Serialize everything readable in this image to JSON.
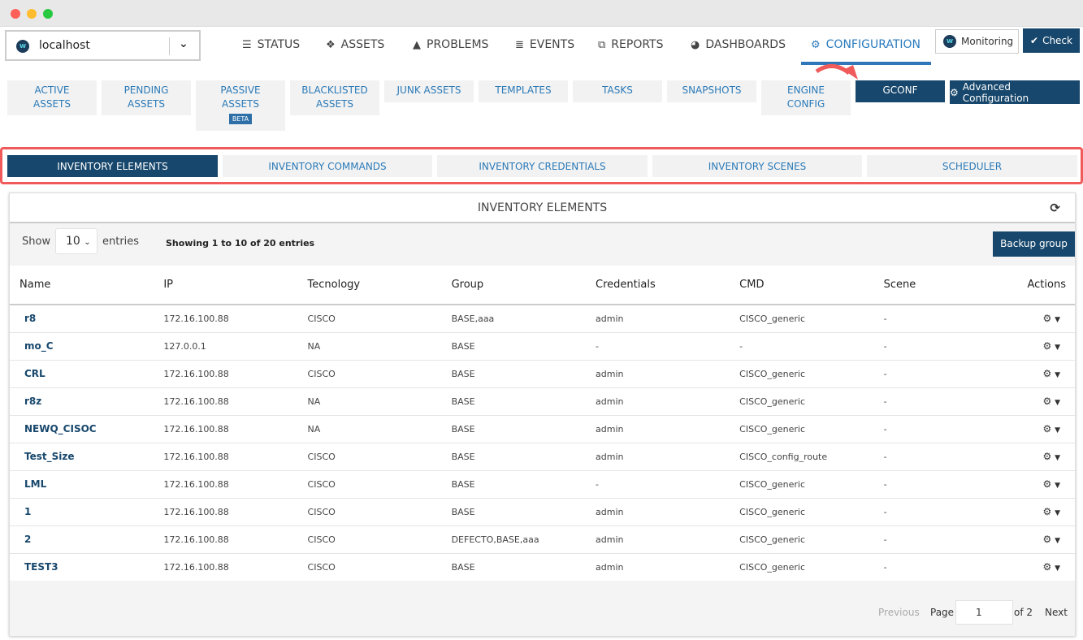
{
  "host": {
    "name": "localhost"
  },
  "nav": [
    {
      "label": "STATUS",
      "icon": "list-icon"
    },
    {
      "label": "ASSETS",
      "icon": "cubes-icon"
    },
    {
      "label": "PROBLEMS",
      "icon": "warning-icon"
    },
    {
      "label": "EVENTS",
      "icon": "database-icon"
    },
    {
      "label": "REPORTS",
      "icon": "copy-icon"
    },
    {
      "label": "DASHBOARDS",
      "icon": "dashboard-icon"
    },
    {
      "label": "CONFIGURATION",
      "icon": "gear-icon",
      "active": true
    }
  ],
  "buttons": {
    "monitoring": "Monitoring",
    "check": "Check",
    "advanced": "Advanced Configuration"
  },
  "subnav": [
    {
      "line1": "ACTIVE",
      "line2": "ASSETS"
    },
    {
      "line1": "PENDING",
      "line2": "ASSETS"
    },
    {
      "line1": "PASSIVE",
      "line2": "ASSETS",
      "badge": "BETA"
    },
    {
      "line1": "BLACKLISTED",
      "line2": "ASSETS"
    },
    {
      "line1": "JUNK ASSETS"
    },
    {
      "line1": "TEMPLATES"
    },
    {
      "line1": "TASKS"
    },
    {
      "line1": "SNAPSHOTS"
    },
    {
      "line1": "ENGINE",
      "line2": "CONFIG"
    },
    {
      "line1": "GCONF",
      "active": true
    }
  ],
  "tabs": [
    "INVENTORY ELEMENTS",
    "INVENTORY COMMANDS",
    "INVENTORY CREDENTIALS",
    "INVENTORY SCENES",
    "SCHEDULER"
  ],
  "panel": {
    "title": "INVENTORY ELEMENTS",
    "show": "Show",
    "page_size": "10",
    "entries": "entries",
    "info": "Showing 1 to 10 of 20 entries",
    "backup": "Backup group"
  },
  "table": {
    "headers": [
      "Name",
      "IP",
      "Tecnology",
      "Group",
      "Credentials",
      "CMD",
      "Scene",
      "Actions"
    ],
    "rows": [
      [
        "r8",
        "172.16.100.88",
        "CISCO",
        "BASE,aaa",
        "admin",
        "CISCO_generic",
        "-"
      ],
      [
        "mo_C",
        "127.0.0.1",
        "NA",
        "BASE",
        "-",
        "-",
        "-"
      ],
      [
        "CRL",
        "172.16.100.88",
        "CISCO",
        "BASE",
        "admin",
        "CISCO_generic",
        "-"
      ],
      [
        "r8z",
        "172.16.100.88",
        "NA",
        "BASE",
        "admin",
        "CISCO_generic",
        "-"
      ],
      [
        "NEWQ_CISOC",
        "172.16.100.88",
        "NA",
        "BASE",
        "admin",
        "CISCO_generic",
        "-"
      ],
      [
        "Test_Size",
        "172.16.100.88",
        "CISCO",
        "BASE",
        "admin",
        "CISCO_config_route",
        "-"
      ],
      [
        "LML",
        "172.16.100.88",
        "CISCO",
        "BASE",
        "-",
        "CISCO_generic",
        "-"
      ],
      [
        "1",
        "172.16.100.88",
        "CISCO",
        "BASE",
        "admin",
        "CISCO_generic",
        "-"
      ],
      [
        "2",
        "172.16.100.88",
        "CISCO",
        "DEFECTO,BASE,aaa",
        "admin",
        "CISCO_generic",
        "-"
      ],
      [
        "TEST3",
        "172.16.100.88",
        "CISCO",
        "BASE",
        "admin",
        "CISCO_generic",
        "-"
      ]
    ]
  },
  "pagination": {
    "previous": "Previous",
    "page": "Page",
    "current": "1",
    "of": "of 2",
    "next": "Next"
  },
  "colors": {
    "primary": "#17476c",
    "link": "#2b7ab8",
    "highlight": "#f05a5a"
  }
}
